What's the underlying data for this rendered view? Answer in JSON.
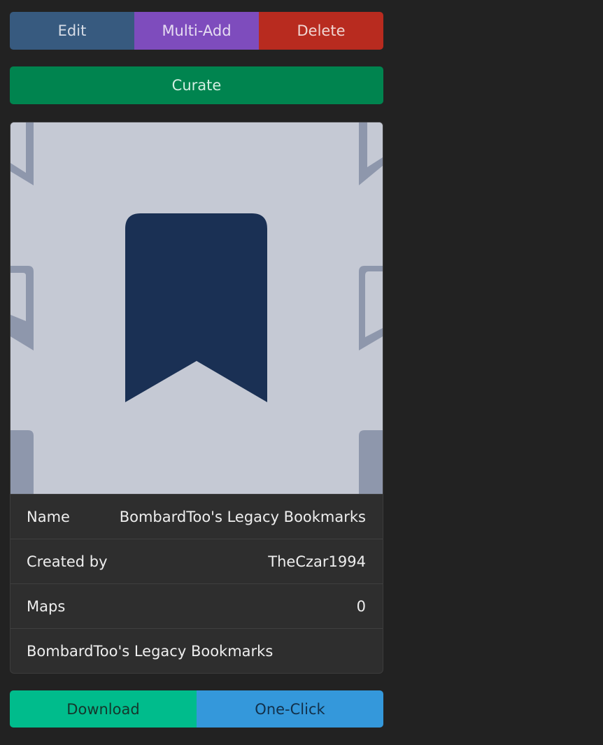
{
  "actions": {
    "edit_label": "Edit",
    "multi_add_label": "Multi-Add",
    "delete_label": "Delete",
    "curate_label": "Curate"
  },
  "playlist": {
    "cover_icon": "bookmark-icon",
    "rows": [
      {
        "label": "Name",
        "value": "BombardToo's Legacy Bookmarks"
      },
      {
        "label": "Created by",
        "value": "TheCzar1994"
      },
      {
        "label": "Maps",
        "value": "0"
      }
    ],
    "description": "BombardToo's Legacy Bookmarks"
  },
  "download": {
    "download_label": "Download",
    "one_click_label": "One-Click"
  },
  "colors": {
    "edit": "#375a7f",
    "multi_add": "#7e4cbd",
    "delete": "#b82b1f",
    "curate": "#00844f",
    "download": "#00bc8c",
    "one_click": "#3498db",
    "bookmark": "#1a3054",
    "cover_bg": "#c5c9d4"
  }
}
